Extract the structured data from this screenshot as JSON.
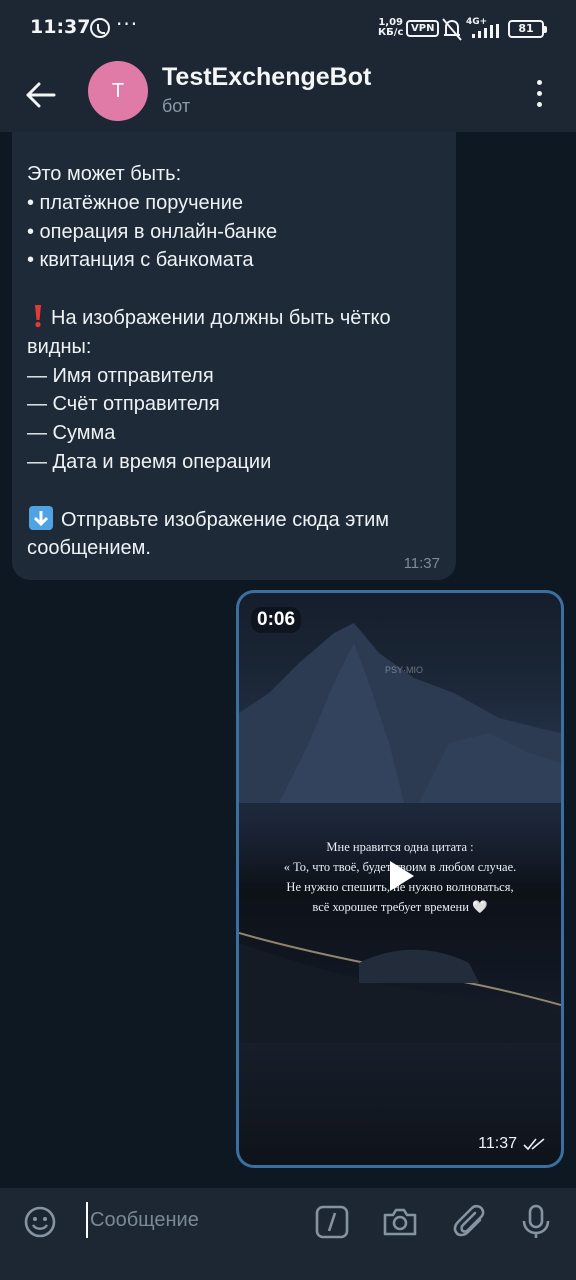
{
  "status_bar": {
    "time": "11:37",
    "speed_value": "1,09",
    "speed_unit": "КБ/с",
    "vpn": "VPN",
    "network": "4G+",
    "battery": "81"
  },
  "header": {
    "avatar_letter": "T",
    "title": "TestExchengeBot",
    "subtitle": "бот",
    "avatar_color": "#e07ba8"
  },
  "incoming_message": {
    "lines": [
      "Это может быть:",
      "• платёжное поручение",
      "• операция в онлайн-банке",
      "• квитанция с банкомата",
      "",
      "На изображении должны быть чётко",
      "видны:",
      "— Имя отправителя",
      "— Счёт отправителя",
      "— Сумма",
      "— Дата и время операции",
      "",
      "Отправьте изображение сюда этим",
      "сообщением."
    ],
    "time": "11:37"
  },
  "video_message": {
    "duration": "0:06",
    "watermark": "PSY·MIO",
    "quote_lines": [
      "Мне нравится одна цитата :",
      "« То, что твоё, будет твоим в любом случае.",
      "Не нужно спешить, не нужно волноваться,",
      "всё хорошее требует времени 🤍"
    ],
    "time": "11:37",
    "border_color": "#3b6fa0"
  },
  "input": {
    "placeholder": "Сообщение"
  }
}
